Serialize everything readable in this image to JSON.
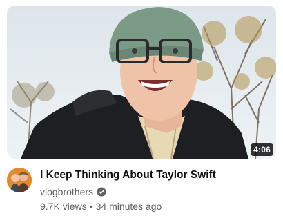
{
  "video": {
    "title": "I Keep Thinking About Taylor Swift",
    "duration": "4:06",
    "thumbnail_icon": "vlog-selfie-thumbnail"
  },
  "channel": {
    "name": "vlogbrothers",
    "avatar_icon": "channel-avatar",
    "verified_icon": "verified-check-icon"
  },
  "stats": {
    "views": "9.7K views",
    "separator": "•",
    "age": "34 minutes ago"
  },
  "colors": {
    "title": "#0f0f0f",
    "secondary_text": "#606060",
    "duration_bg": "#000000cc",
    "duration_text": "#ffffff"
  }
}
